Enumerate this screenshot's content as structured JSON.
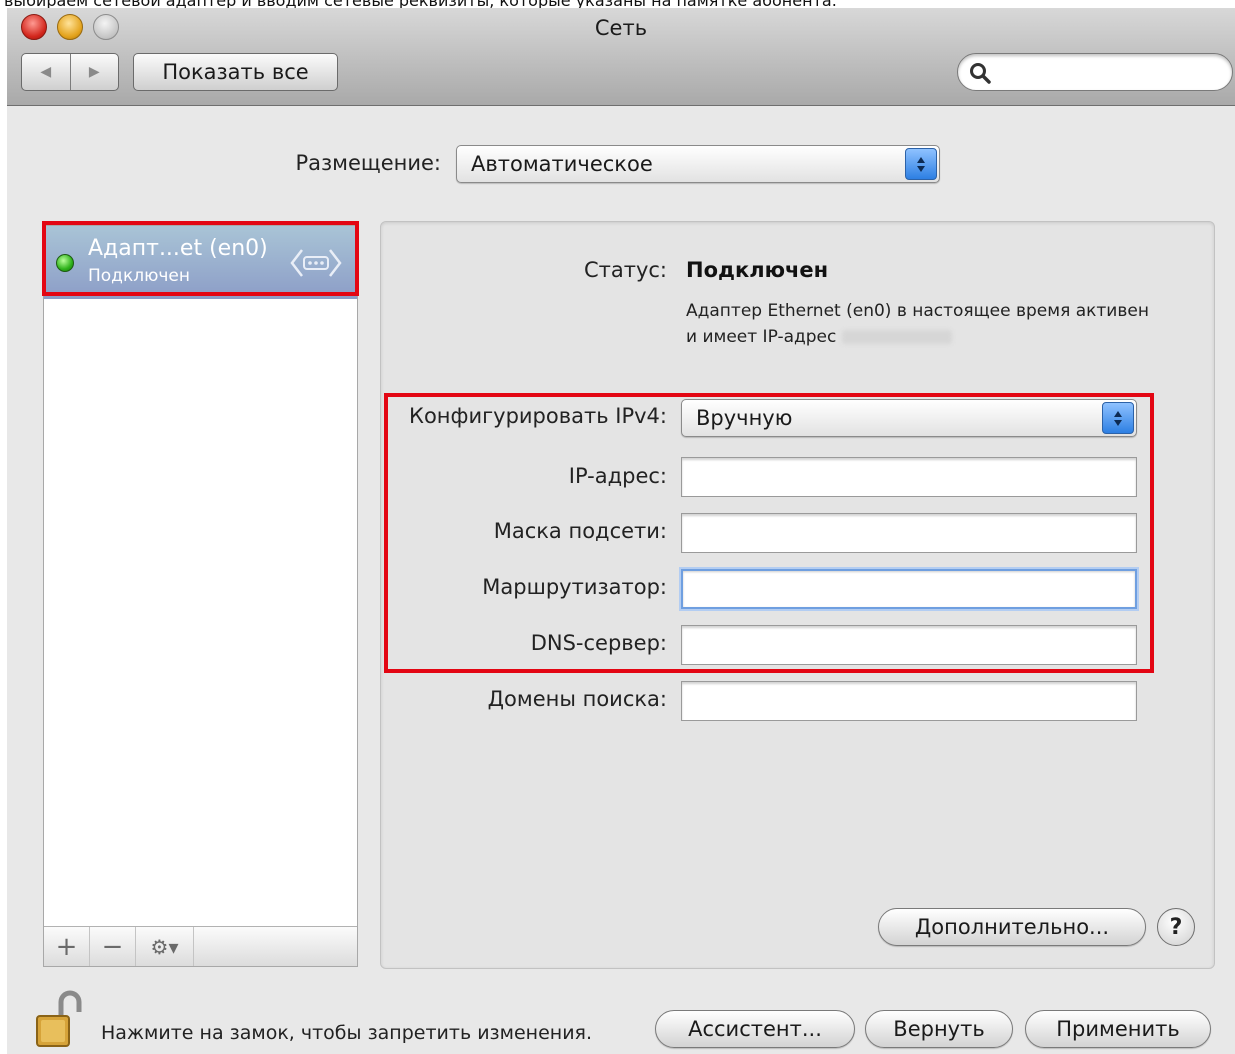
{
  "caption": "выбираем сетевой адаптер и вводим сетевые реквизиты, которые указаны на памятке абонента.",
  "window": {
    "title": "Сеть"
  },
  "toolbar": {
    "back_icon": "back-arrow-icon",
    "forward_icon": "forward-arrow-icon",
    "show_all": "Показать все",
    "search_placeholder": ""
  },
  "location": {
    "label": "Размещение:",
    "value": "Автоматическое"
  },
  "interfaces": [
    {
      "name": "Адапт...et (en0)",
      "status": "Подключен",
      "status_color": "#2fb21b"
    }
  ],
  "list_controls": {
    "add": "+",
    "remove": "−",
    "gear": "⚙▾"
  },
  "status": {
    "label": "Статус:",
    "value": "Подключен",
    "description": "Адаптер Ethernet (en0) в настоящее время активен и имеет IP-адрес"
  },
  "config": {
    "label": "Конфигурировать IPv4:",
    "value": "Вручную"
  },
  "fields": {
    "ip": {
      "label": "IP-адрес:",
      "value": ""
    },
    "mask": {
      "label": "Маска подсети:",
      "value": ""
    },
    "router": {
      "label": "Маршрутизатор:",
      "value": ""
    },
    "dns": {
      "label": "DNS-сервер:",
      "value": ""
    },
    "search_domains": {
      "label": "Домены поиска:",
      "value": ""
    }
  },
  "buttons": {
    "advanced": "Дополнительно...",
    "help": "?",
    "assistant": "Ассистент...",
    "revert": "Вернуть",
    "apply": "Применить"
  },
  "lock": {
    "text": "Нажмите на замок, чтобы запретить изменения."
  },
  "colors": {
    "highlight": "#e30613",
    "selection": "#8c9dc7",
    "accent": "#2d7fe3"
  }
}
